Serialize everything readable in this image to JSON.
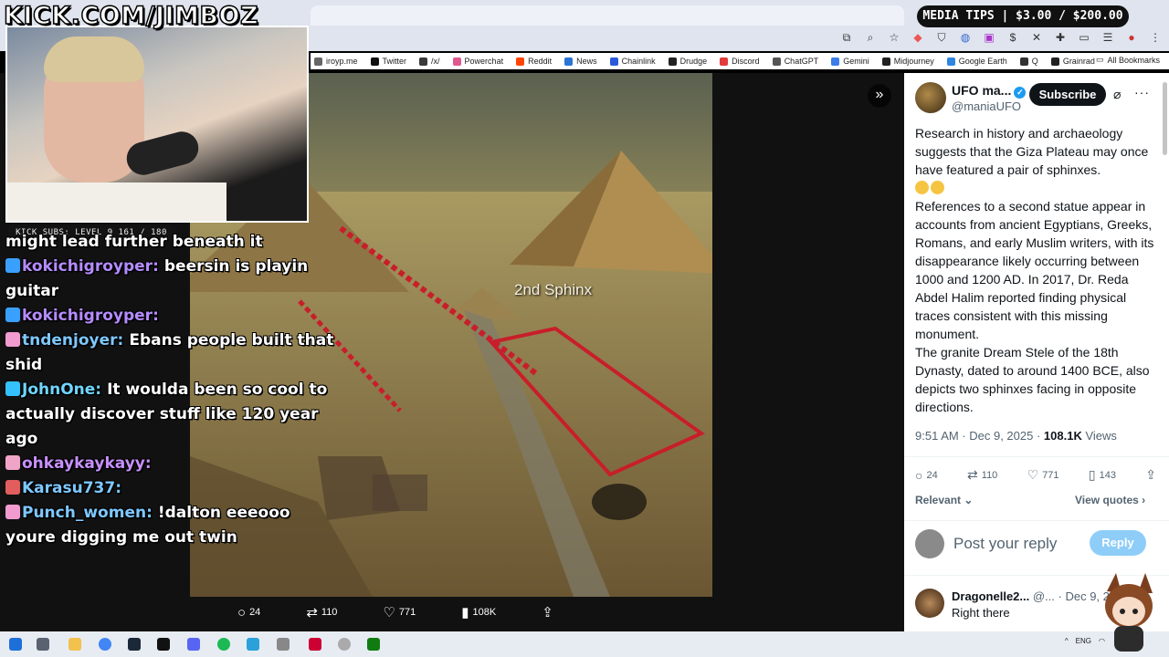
{
  "overlay": {
    "channel_banner": "KICK.COM/JIMBOZ",
    "media_tips": "MEDIA TIPS | $3.00 / $200.00",
    "subs_badge": "KICK SUBS: LEVEL 9 161 / 180"
  },
  "browser": {
    "bookmarks": [
      {
        "label": "iroyp.me",
        "color": "#666666"
      },
      {
        "label": "Twitter",
        "color": "#111111"
      },
      {
        "label": "/x/",
        "color": "#3a3a3a"
      },
      {
        "label": "Powerchat",
        "color": "#e0588f"
      },
      {
        "label": "Reddit",
        "color": "#ff4500"
      },
      {
        "label": "News",
        "color": "#2a74d6"
      },
      {
        "label": "Chainlink",
        "color": "#2a5ada"
      },
      {
        "label": "Drudge",
        "color": "#222222"
      },
      {
        "label": "Discord",
        "color": "#e23b3b"
      },
      {
        "label": "ChatGPT",
        "color": "#555555"
      },
      {
        "label": "Gemini",
        "color": "#3b7ee9"
      },
      {
        "label": "Midjourney",
        "color": "#222222"
      },
      {
        "label": "Google Earth",
        "color": "#2f86e0"
      },
      {
        "label": "Q",
        "color": "#333333"
      },
      {
        "label": "Grainrad",
        "color": "#222222"
      }
    ],
    "all_bookmarks": "All Bookmarks"
  },
  "chat": [
    {
      "user": "",
      "text": "might lead further beneath it",
      "user_color": "#ffffff",
      "badge": ""
    },
    {
      "user": "kokichigroyper:",
      "text": "beersin is playin guitar",
      "user_color": "#b58cff",
      "badge": "#3aa0ff"
    },
    {
      "user": "kokichigroyper:",
      "text": "",
      "user_color": "#b58cff",
      "badge": "#3aa0ff"
    },
    {
      "user": "tndenjoyer:",
      "text": "Ebans people built that shid",
      "user_color": "#7ec8ff",
      "badge": "#f29bd0"
    },
    {
      "user": "JohnOne:",
      "text": "It woulda been so cool to actually discover stuff like 120 year ago",
      "user_color": "#6fd6ff",
      "badge": "#35c0ff"
    },
    {
      "user": "ohkaykaykayy:",
      "text": "",
      "user_color": "#c890ff",
      "badge": "#f0a5c8"
    },
    {
      "user": "Karasu737:",
      "text": "",
      "user_color": "#7ec8ff",
      "badge": "#e25d5d"
    },
    {
      "user": "Punch_women:",
      "text": "!dalton eeeooo youre digging me out twin",
      "user_color": "#7ec8ff",
      "badge": "#f29bd0"
    }
  ],
  "image": {
    "label": "2nd Sphinx"
  },
  "media_actions": {
    "replies": "24",
    "reposts": "110",
    "likes": "771",
    "views": "108K"
  },
  "tweet": {
    "author_name": "UFO ma...",
    "author_handle": "@maniaUFO",
    "subscribe_label": "Subscribe",
    "paragraphs": [
      "Research in history and archaeology suggests that the Giza Plateau may once have featured a pair of sphinxes.",
      "References to a second statue appear in accounts from ancient Egyptians, Greeks, Romans, and early Muslim writers, with its disappearance likely occurring between 1000 and 1200 AD. In 2017, Dr. Reda Abdel Halim reported finding physical traces consistent with this missing monument.",
      "The granite Dream Stele of the 18th Dynasty, dated to around 1400 BCE, also depicts two sphinxes facing in opposite directions."
    ],
    "timestamp": "9:51 AM · Dec 9, 2025 ·",
    "views_count": "108.1K",
    "views_label": "Views",
    "stats": {
      "replies": "24",
      "reposts": "110",
      "likes": "771",
      "bookmarks": "143"
    },
    "relevant_label": "Relevant",
    "view_quotes_label": "View quotes",
    "reply_placeholder": "Post your reply",
    "reply_button": "Reply",
    "comment": {
      "name": "Dragonelle2...",
      "meta": "@... · Dec 9, 2",
      "text": "Right there"
    }
  },
  "colors": {
    "accent_blue": "#1d9bf0",
    "route_red": "#c81e2a"
  }
}
